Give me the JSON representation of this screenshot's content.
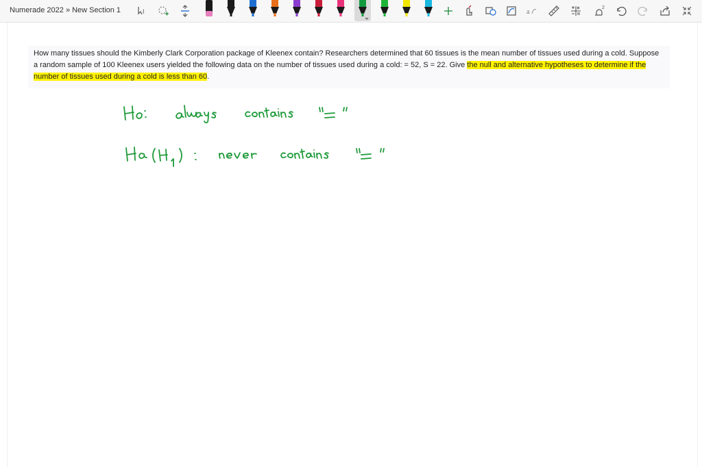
{
  "toolbar": {
    "breadcrumb": "Numerade 2022 » New Section 1",
    "tools": [
      "type-select-icon",
      "lasso-add-icon",
      "insert-space-icon"
    ],
    "pens": [
      {
        "color": "#e77fbf",
        "selected": false
      },
      {
        "color": "#1a1a1a",
        "selected": false
      },
      {
        "color": "#1f6fd1",
        "selected": false
      },
      {
        "color": "#e8701a",
        "selected": false
      },
      {
        "color": "#8a3ccf",
        "selected": false
      },
      {
        "color": "#c81e3a",
        "selected": false
      },
      {
        "color": "#e8337a",
        "selected": false
      },
      {
        "color": "#119a3e",
        "selected": true
      },
      {
        "color": "#1fb53a",
        "selected": false
      },
      {
        "color": "#f2e600",
        "selected": false
      },
      {
        "color": "#19b8e0",
        "selected": false
      }
    ],
    "right_tools": [
      "add-pen-icon",
      "touch-draw-icon",
      "shape-icon",
      "ink-to-shape-icon",
      "ink-to-text-icon",
      "ruler-icon",
      "math-icon",
      "replay-icon",
      "undo-icon",
      "redo-icon",
      "share-icon",
      "fullscreen-icon"
    ]
  },
  "question": {
    "text_plain": "How many tissues should the Kimberly Clark Corporation package of Kleenex contain? Researchers determined that 60 tissues is the mean number of tissues used during a cold. Suppose a random sample of 100 Kleenex users yielded the following data on the number of tissues used during a cold: = 52, S = 22. Give ",
    "text_highlighted": "the null and alternative hypotheses to determine if the number of tissues used during a cold is less than 60",
    "text_end": "."
  },
  "ink": {
    "color": "#1f9a3a",
    "line1": "Ho: always contains \"=\"",
    "line2": "Ha(H1): never contains \"=\""
  }
}
